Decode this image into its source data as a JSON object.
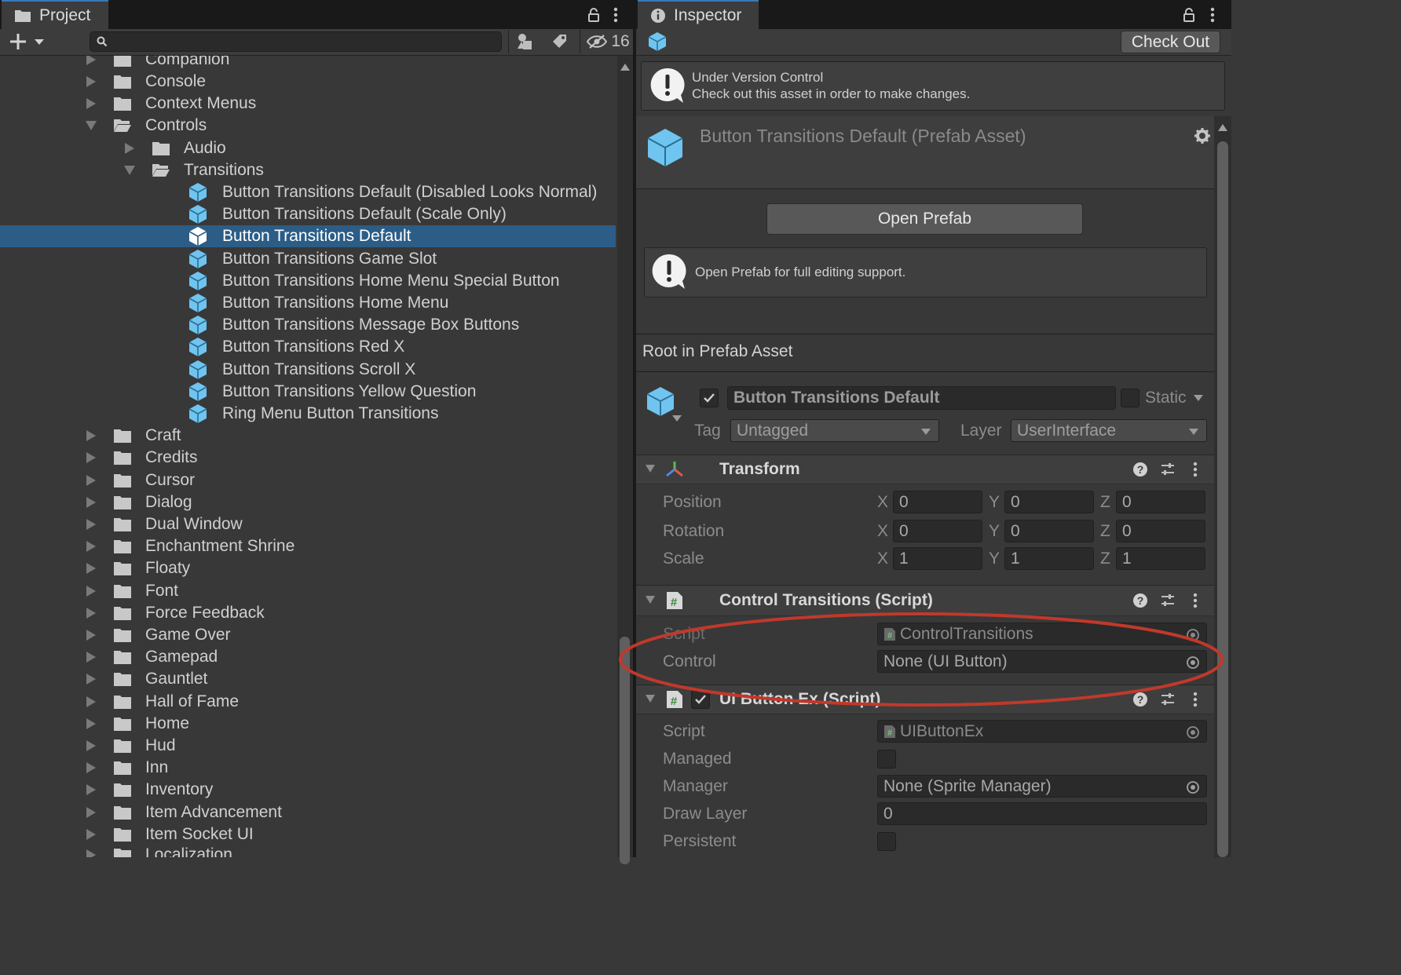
{
  "project": {
    "tab_label": "Project",
    "search_placeholder": "",
    "hidden_count": "16",
    "partial_top_item": "Companion",
    "rows": [
      {
        "label": "Console",
        "kind": "folder",
        "level": 1,
        "expand": "collapsed"
      },
      {
        "label": "Context Menus",
        "kind": "folder",
        "level": 1,
        "expand": "collapsed"
      },
      {
        "label": "Controls",
        "kind": "folder",
        "level": 1,
        "expand": "expanded"
      },
      {
        "label": "Audio",
        "kind": "folder",
        "level": 2,
        "expand": "collapsed"
      },
      {
        "label": "Transitions",
        "kind": "folder",
        "level": 2,
        "expand": "expanded"
      },
      {
        "label": "Button Transitions Default (Disabled Looks Normal)",
        "kind": "prefab",
        "level": 3
      },
      {
        "label": "Button Transitions Default (Scale Only)",
        "kind": "prefab",
        "level": 3
      },
      {
        "label": "Button Transitions Default",
        "kind": "prefab",
        "level": 3,
        "selected": true
      },
      {
        "label": "Button Transitions Game Slot",
        "kind": "prefab",
        "level": 3
      },
      {
        "label": "Button Transitions Home Menu Special Button",
        "kind": "prefab",
        "level": 3
      },
      {
        "label": "Button Transitions Home Menu",
        "kind": "prefab",
        "level": 3
      },
      {
        "label": "Button Transitions Message Box Buttons",
        "kind": "prefab",
        "level": 3
      },
      {
        "label": "Button Transitions Red X",
        "kind": "prefab",
        "level": 3
      },
      {
        "label": "Button Transitions Scroll X",
        "kind": "prefab",
        "level": 3
      },
      {
        "label": "Button Transitions Yellow Question",
        "kind": "prefab",
        "level": 3
      },
      {
        "label": "Ring Menu Button Transitions",
        "kind": "prefab",
        "level": 3
      },
      {
        "label": "Craft",
        "kind": "folder",
        "level": 1,
        "expand": "collapsed"
      },
      {
        "label": "Credits",
        "kind": "folder",
        "level": 1,
        "expand": "collapsed"
      },
      {
        "label": "Cursor",
        "kind": "folder",
        "level": 1,
        "expand": "collapsed"
      },
      {
        "label": "Dialog",
        "kind": "folder",
        "level": 1,
        "expand": "collapsed"
      },
      {
        "label": "Dual Window",
        "kind": "folder",
        "level": 1,
        "expand": "collapsed"
      },
      {
        "label": "Enchantment Shrine",
        "kind": "folder",
        "level": 1,
        "expand": "collapsed"
      },
      {
        "label": "Floaty",
        "kind": "folder",
        "level": 1,
        "expand": "collapsed"
      },
      {
        "label": "Font",
        "kind": "folder",
        "level": 1,
        "expand": "collapsed"
      },
      {
        "label": "Force Feedback",
        "kind": "folder",
        "level": 1,
        "expand": "collapsed"
      },
      {
        "label": "Game Over",
        "kind": "folder",
        "level": 1,
        "expand": "collapsed"
      },
      {
        "label": "Gamepad",
        "kind": "folder",
        "level": 1,
        "expand": "collapsed"
      },
      {
        "label": "Gauntlet",
        "kind": "folder",
        "level": 1,
        "expand": "collapsed"
      },
      {
        "label": "Hall of Fame",
        "kind": "folder",
        "level": 1,
        "expand": "collapsed"
      },
      {
        "label": "Home",
        "kind": "folder",
        "level": 1,
        "expand": "collapsed"
      },
      {
        "label": "Hud",
        "kind": "folder",
        "level": 1,
        "expand": "collapsed"
      },
      {
        "label": "Inn",
        "kind": "folder",
        "level": 1,
        "expand": "collapsed"
      },
      {
        "label": "Inventory",
        "kind": "folder",
        "level": 1,
        "expand": "collapsed"
      },
      {
        "label": "Item Advancement",
        "kind": "folder",
        "level": 1,
        "expand": "collapsed"
      },
      {
        "label": "Item Socket UI",
        "kind": "folder",
        "level": 1,
        "expand": "collapsed"
      }
    ],
    "partial_bottom_item": "Localization"
  },
  "inspector": {
    "tab_label": "Inspector",
    "check_out_label": "Check Out",
    "vc_title": "Under Version Control",
    "vc_message": "Check out this asset in order to make changes.",
    "asset_title": "Button Transitions Default (Prefab Asset)",
    "open_prefab_label": "Open Prefab",
    "open_prefab_help": "Open Prefab for full editing support.",
    "root_label": "Root in Prefab Asset",
    "gameobject_name": "Button Transitions Default",
    "static_label": "Static",
    "tag_label": "Tag",
    "tag_value": "Untagged",
    "layer_label": "Layer",
    "layer_value": "UserInterface",
    "transform": {
      "title": "Transform",
      "position_label": "Position",
      "rotation_label": "Rotation",
      "scale_label": "Scale",
      "x": "X",
      "y": "Y",
      "z": "Z",
      "position": [
        "0",
        "0",
        "0"
      ],
      "rotation": [
        "0",
        "0",
        "0"
      ],
      "scale": [
        "1",
        "1",
        "1"
      ]
    },
    "control_transitions": {
      "title": "Control Transitions (Script)",
      "script_label": "Script",
      "script_value": "ControlTransitions",
      "control_label": "Control",
      "control_value": "None (UI Button)"
    },
    "ui_button_ex": {
      "title": "UI Button Ex (Script)",
      "script_label": "Script",
      "script_value": "UIButtonEx",
      "managed_label": "Managed",
      "manager_label": "Manager",
      "manager_value": "None (Sprite Manager)",
      "draw_layer_label": "Draw Layer",
      "draw_layer_value": "0",
      "persistent_label": "Persistent"
    }
  },
  "colors": {
    "selection": "#2c5d87",
    "prefab_icon": "#6fc4f0",
    "annotation": "#c0392b"
  }
}
